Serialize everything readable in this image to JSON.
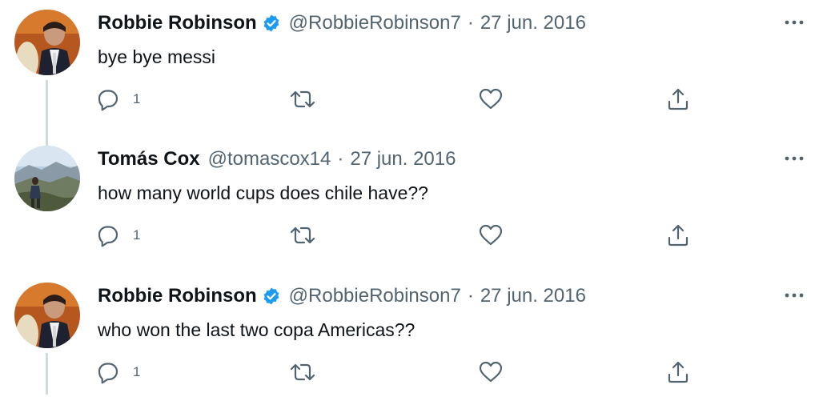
{
  "colors": {
    "text_primary": "#0f1419",
    "text_secondary": "#536471",
    "verified_blue": "#1d9bf0",
    "thread_line": "#cfd9de"
  },
  "tweets": [
    {
      "name": "Robbie Robinson",
      "verified": true,
      "handle": "@RobbieRobinson7",
      "separator": "·",
      "date": "27 jun. 2016",
      "text": "bye bye messi",
      "reply_count": "1"
    },
    {
      "name": "Tomás Cox",
      "verified": false,
      "handle": "@tomascox14",
      "separator": "·",
      "date": "27 jun. 2016",
      "text": "how many world cups does chile have??",
      "reply_count": "1"
    },
    {
      "name": "Robbie Robinson",
      "verified": true,
      "handle": "@RobbieRobinson7",
      "separator": "·",
      "date": "27 jun. 2016",
      "text": "who won the last two copa Americas??",
      "reply_count": "1"
    }
  ],
  "icons": {
    "reply": "reply-icon",
    "retweet": "retweet-icon",
    "like": "heart-icon",
    "share": "share-icon",
    "more": "more-icon",
    "verified": "verified-badge-icon"
  }
}
